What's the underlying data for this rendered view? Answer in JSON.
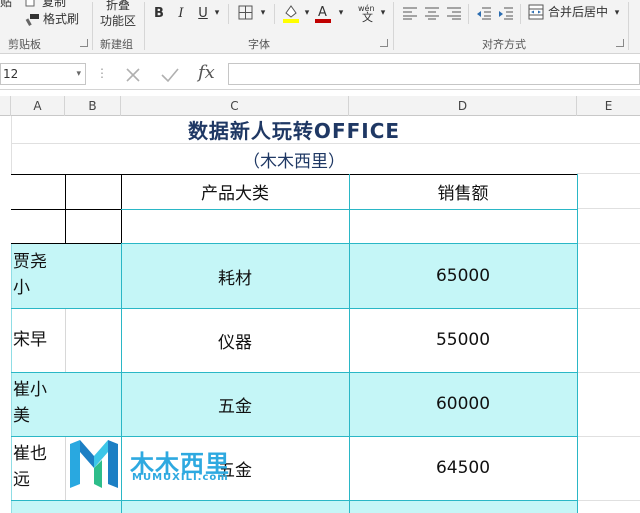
{
  "ribbon": {
    "clipboard": {
      "paste_label": "贴",
      "copy_label": "复制",
      "format_painter_label": "格式刷",
      "group_label": "剪贴板"
    },
    "new_group": {
      "fold_label_line1": "折叠",
      "fold_label_line2": "功能区",
      "group_label": "新建组"
    },
    "font": {
      "bold": "B",
      "italic": "I",
      "underline": "U",
      "wen_top": "wén",
      "wen_bottom": "文",
      "group_label": "字体",
      "fill_color": "#ffff00",
      "font_color": "#c00000"
    },
    "alignment": {
      "merge_label": "合并后居中",
      "group_label": "对齐方式"
    }
  },
  "formula_bar": {
    "name_box_value": "12",
    "fx_label": "fx",
    "formula_value": ""
  },
  "columns": [
    "A",
    "B",
    "C",
    "D",
    "E"
  ],
  "sheet": {
    "title": "数据新人玩转OFFICE",
    "subtitle": "（木木西里）",
    "header_product": "产品大类",
    "header_sales": "销售额",
    "rows": [
      {
        "name_line1": "贾尧",
        "name_line2": "小",
        "product": "耗材",
        "sales": "65000"
      },
      {
        "name_line1": "宋早",
        "name_line2": "",
        "product": "仪器",
        "sales": "55000"
      },
      {
        "name_line1": "崔小",
        "name_line2": "美",
        "product": "五金",
        "sales": "60000"
      },
      {
        "name_line1": "崔也",
        "name_line2": "远",
        "product": "五金",
        "sales": "64500"
      }
    ]
  },
  "watermark": {
    "brand": "木木西里",
    "url": "MUMUXILI.com"
  },
  "colors": {
    "accent_cyan": "#c5f6f7",
    "border_teal": "#2ab7c6",
    "title_color": "#1f3864"
  }
}
